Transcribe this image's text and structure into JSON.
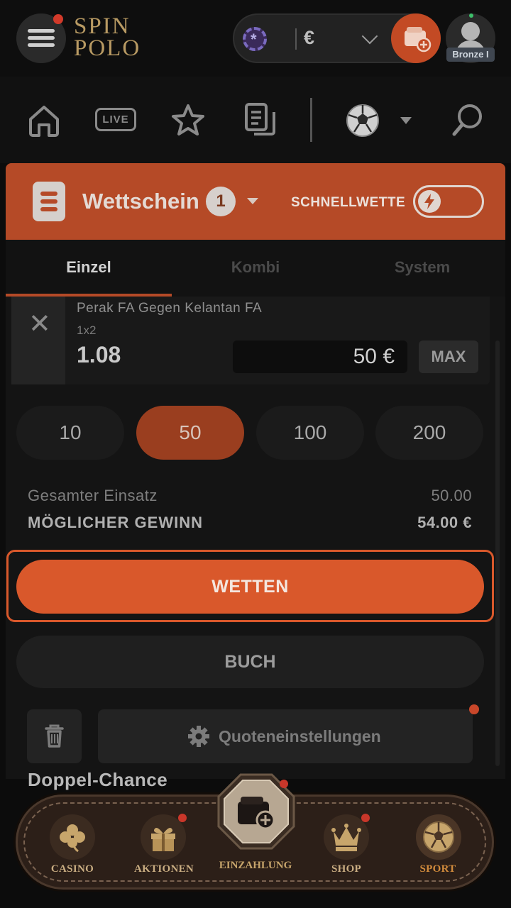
{
  "header": {
    "logo_line1": "SPIN",
    "logo_line2": "POLO",
    "currency": "€",
    "rank": "Bronze I"
  },
  "nav": {
    "live_label": "LIVE"
  },
  "betslip": {
    "title": "Wettschein",
    "count": "1",
    "quick_bet_label": "SCHNELLWETTE",
    "tabs": [
      {
        "label": "Einzel",
        "active": true
      },
      {
        "label": "Kombi",
        "active": false
      },
      {
        "label": "System",
        "active": false
      }
    ],
    "selection": {
      "match": "Perak FA Gegen Kelantan FA",
      "market": "1x2",
      "odds": "1.08",
      "stake": "50 €",
      "max_label": "MAX"
    },
    "quick_stakes": [
      {
        "label": "10",
        "active": false
      },
      {
        "label": "50",
        "active": true
      },
      {
        "label": "100",
        "active": false
      },
      {
        "label": "200",
        "active": false
      }
    ],
    "total_label": "Gesamter Einsatz",
    "total_value": "50.00",
    "win_label": "MÖGLICHER GEWINN",
    "win_value": "54.00 €",
    "bet_button": "WETTEN",
    "book_button": "BUCH",
    "odds_settings": "Quoteneinstellungen",
    "section_title": "Doppel-Chance"
  },
  "bottom_nav": [
    {
      "label": "CASINO",
      "icon": "clover-icon"
    },
    {
      "label": "AKTIONEN",
      "icon": "gift-icon"
    },
    {
      "label": "EINZAHLUNG",
      "icon": "wallet-plus-icon"
    },
    {
      "label": "SHOP",
      "icon": "crown-icon"
    },
    {
      "label": "SPORT",
      "icon": "soccer-ball-icon"
    }
  ],
  "colors": {
    "accent": "#d9582b",
    "slip_header": "#b54a27",
    "gold": "#c9ad82"
  }
}
